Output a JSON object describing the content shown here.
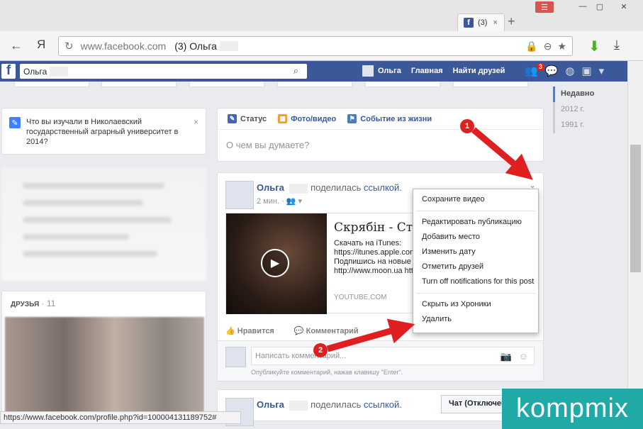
{
  "browser": {
    "tab_title": "(3)",
    "tab_close": "×",
    "new_tab": "+",
    "url": "www.facebook.com",
    "page_title": "(3) Ольга",
    "yandex_logo": "Я",
    "status_url": "https://www.facebook.com/profile.php?id=100004131189752#"
  },
  "fb": {
    "search_value": "Ольга",
    "nav_user": "Ольга",
    "nav_home": "Главная",
    "nav_friends": "Найти друзей",
    "friend_requests_badge": "3"
  },
  "prompt": {
    "text": "Что вы изучали в Николаевский государственный аграрный университет в 2014?",
    "close": "×"
  },
  "friends": {
    "title": "ДРУЗЬЯ",
    "count": "11"
  },
  "composer": {
    "tab_status": "Статус",
    "tab_photo": "Фото/видео",
    "tab_event": "Событие из жизни",
    "placeholder": "О чем вы думаете?"
  },
  "post": {
    "author": "Ольга",
    "action": "поделилась",
    "link_word": "ссылкой.",
    "time": "2 мин.",
    "link_title": "Скрябін - Старі",
    "link_desc": [
      "Скачать на iTunes:",
      "https://itunes.apple.com",
      "Подпишись на новые",
      "http://www.moon.ua http"
    ],
    "link_source": "YOUTUBE.COM",
    "like": "Нравится",
    "comment": "Комментарий",
    "comment_placeholder": "Написать комментарий...",
    "comment_hint": "Опубликуйте комментарий, нажав клавишу \"Enter\"."
  },
  "post2": {
    "author": "Ольга",
    "action": "поделилась",
    "link_word": "ссылкой."
  },
  "dropdown": {
    "items_top": [
      "Сохраните видео"
    ],
    "items_mid": [
      "Редактировать публикацию",
      "Добавить место",
      "Изменить дату",
      "Отметить друзей",
      "Turn off notifications for this post"
    ],
    "items_bottom": [
      "Скрыть из Хроники",
      "Удалить"
    ]
  },
  "timeline": {
    "years": [
      "Недавно",
      "2012 г.",
      "1991 г."
    ]
  },
  "chat": {
    "label": "Чат (Отключен"
  },
  "markers": [
    "1",
    "2"
  ],
  "watermark": "kompmix",
  "colors": {
    "fb_blue": "#3b5998",
    "arrow_red": "#e02020",
    "watermark_teal": "#1faaa8"
  }
}
